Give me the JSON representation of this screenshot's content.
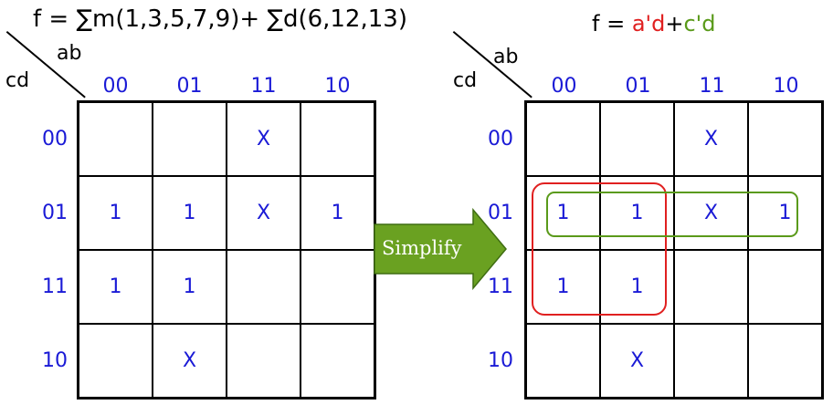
{
  "left": {
    "title": "f = ∑m(1,3,5,7,9)+ ∑d(6,12,13)",
    "kmap": {
      "col_var": "ab",
      "row_var": "cd",
      "col_labels": [
        "00",
        "01",
        "11",
        "10"
      ],
      "row_labels": [
        "00",
        "01",
        "11",
        "10"
      ],
      "cells": [
        [
          "",
          "",
          "X",
          ""
        ],
        [
          "1",
          "1",
          "X",
          "1"
        ],
        [
          "1",
          "1",
          "",
          ""
        ],
        [
          "",
          "X",
          "",
          ""
        ]
      ]
    }
  },
  "arrow": {
    "label": "Simplify",
    "color": "#6aa121"
  },
  "right": {
    "title_prefix": "f = ",
    "term1": "a'd",
    "plus": "+",
    "term2": "c'd",
    "term1_color": "#e02020",
    "term2_color": "#5a9a1a",
    "kmap": {
      "col_var": "ab",
      "row_var": "cd",
      "col_labels": [
        "00",
        "01",
        "11",
        "10"
      ],
      "row_labels": [
        "00",
        "01",
        "11",
        "10"
      ],
      "cells": [
        [
          "",
          "",
          "X",
          ""
        ],
        [
          "1",
          "1",
          "X",
          "1"
        ],
        [
          "1",
          "1",
          "",
          ""
        ],
        [
          "",
          "X",
          "",
          ""
        ]
      ]
    }
  }
}
